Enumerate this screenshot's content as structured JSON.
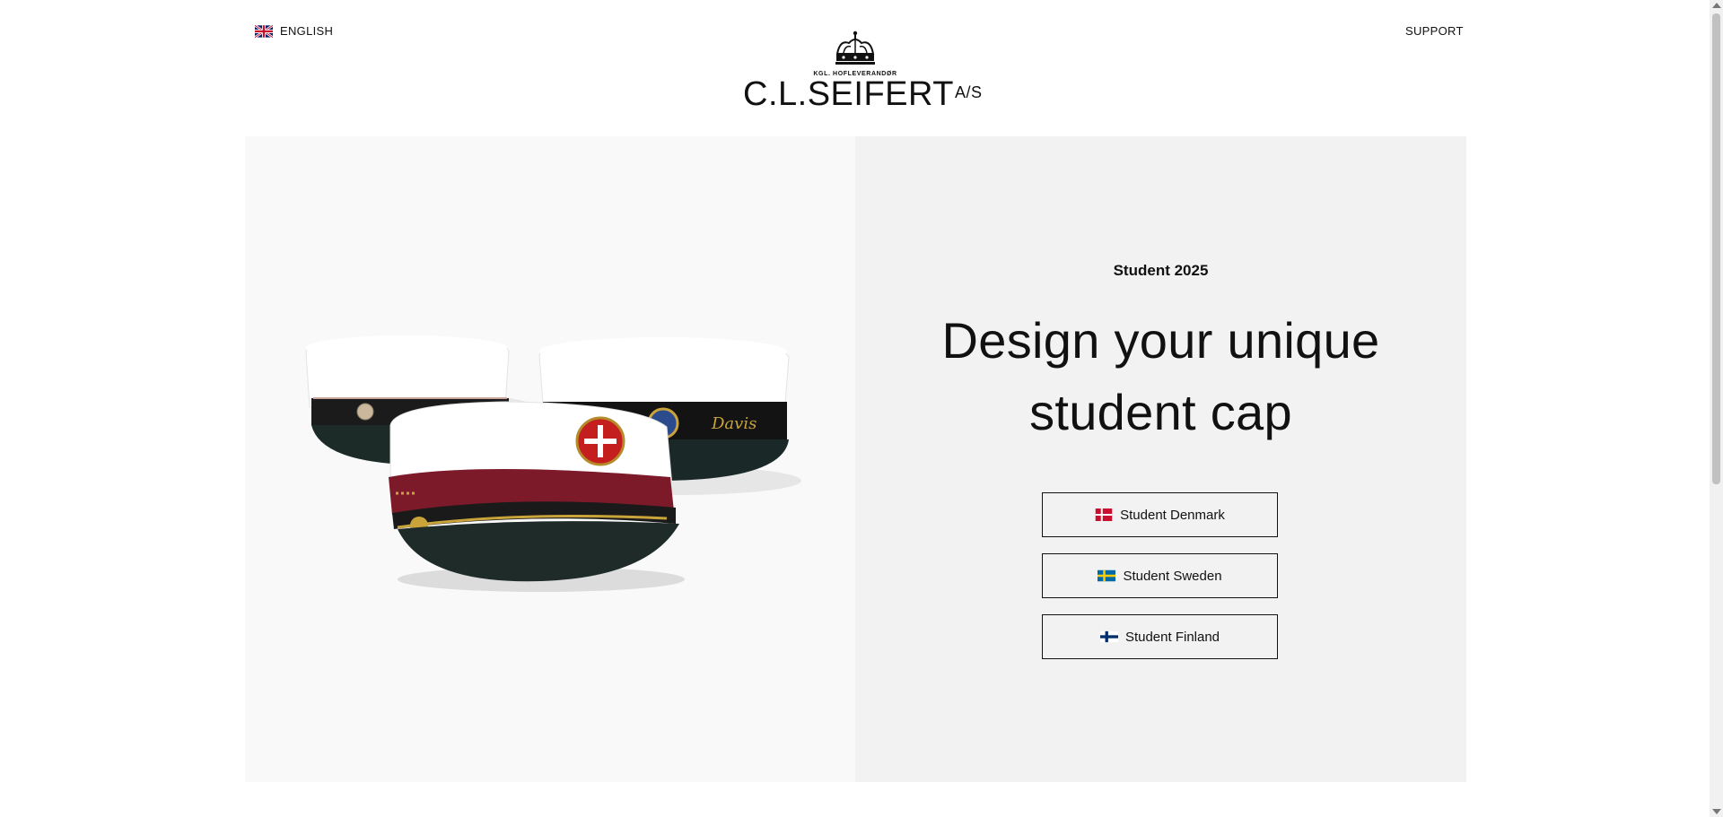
{
  "header": {
    "language_label": "ENGLISH",
    "language_flag_icon": "uk-flag-icon",
    "support_label": "SUPPORT",
    "logo": {
      "tagline": "KGL. HOFLEVERANDØR",
      "wordmark": "C.L.SEIFERT",
      "suffix": "A/S",
      "icon": "crown-icon"
    }
  },
  "hero": {
    "image_icon": "student-caps-image",
    "eyebrow": "Student 2025",
    "headline_line1": "Design your unique",
    "headline_line2": "student cap",
    "buttons": [
      {
        "label": "Student Denmark",
        "icon": "denmark-flag-icon"
      },
      {
        "label": "Student Sweden",
        "icon": "sweden-flag-icon"
      },
      {
        "label": "Student Finland",
        "icon": "finland-flag-icon"
      }
    ]
  },
  "colors": {
    "page_bg": "#ffffff",
    "left_panel_bg": "#f9f9f9",
    "right_panel_bg": "#f2f2f2",
    "text": "#111111"
  }
}
